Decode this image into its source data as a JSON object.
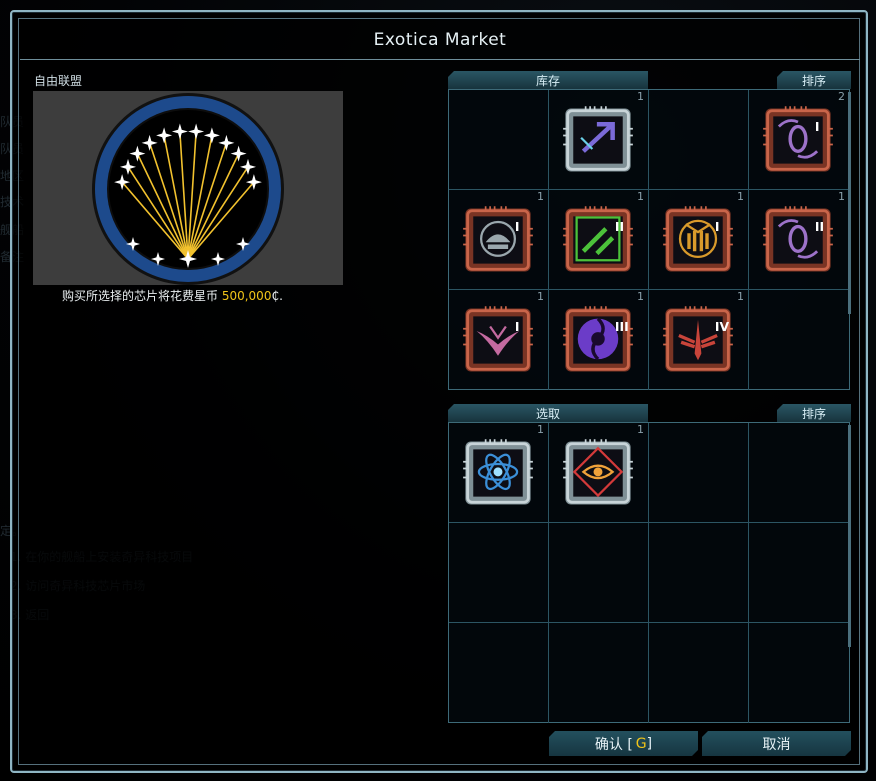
{
  "window": {
    "title": "Exotica Market"
  },
  "faction": {
    "name": "自由联盟"
  },
  "cost": {
    "prefix": "购买所选择的芯片将花费星币 ",
    "amount": "500,000",
    "unit": "₵."
  },
  "background_ghost": {
    "lines": [
      "队员",
      "队员",
      "地区",
      "技术",
      "舰船",
      "备注",
      "定。",
      "1. 在你的舰船上安装奇异科技项目",
      "2. 访问奇异科技芯片市场",
      "3. 返回"
    ]
  },
  "inventory": {
    "tab_label": "库存",
    "sort_label": "排序",
    "cells": [
      {
        "count": "",
        "chip": null
      },
      {
        "count": "1",
        "chip": {
          "icon": "arrow-shard-icon",
          "frame": "silver",
          "color": "#7b6ad8",
          "tier": ""
        }
      },
      {
        "count": "",
        "chip": null
      },
      {
        "count": "2",
        "chip": {
          "icon": "vortex-zero-icon",
          "frame": "copper",
          "color": "#9d72c9",
          "tier": "I"
        }
      },
      {
        "count": "1",
        "chip": {
          "icon": "dome-turret-icon",
          "frame": "copper",
          "color": "#9aa7ad",
          "tier": "I"
        }
      },
      {
        "count": "1",
        "chip": {
          "icon": "green-arrows-icon",
          "frame": "copper",
          "color": "#4cc23a",
          "tier": "II"
        }
      },
      {
        "count": "1",
        "chip": {
          "icon": "missile-volley-icon",
          "frame": "copper",
          "color": "#d99a2b",
          "tier": "I"
        }
      },
      {
        "count": "1",
        "chip": {
          "icon": "vortex-zero-icon",
          "frame": "copper",
          "color": "#9d72c9",
          "tier": "II"
        }
      },
      {
        "count": "1",
        "chip": {
          "icon": "winged-shield-icon",
          "frame": "copper",
          "color": "#c46aa0",
          "tier": "I"
        }
      },
      {
        "count": "1",
        "chip": {
          "icon": "purple-swirl-icon",
          "frame": "copper",
          "color": "#6b3cc8",
          "tier": "III"
        }
      },
      {
        "count": "1",
        "chip": {
          "icon": "red-wing-dagger-icon",
          "frame": "copper",
          "color": "#c8443a",
          "tier": "IV"
        }
      },
      {
        "count": "",
        "chip": null
      }
    ]
  },
  "selection": {
    "tab_label": "选取",
    "sort_label": "排序",
    "cells": [
      {
        "count": "1",
        "chip": {
          "icon": "atom-star-icon",
          "frame": "silver",
          "color": "#3b8fd8",
          "tier": ""
        }
      },
      {
        "count": "1",
        "chip": {
          "icon": "red-eye-diamond-icon",
          "frame": "silver",
          "color": "#d43a3a",
          "tier": ""
        }
      },
      {
        "count": "",
        "chip": null
      },
      {
        "count": "",
        "chip": null
      },
      {
        "count": "",
        "chip": null
      },
      {
        "count": "",
        "chip": null
      },
      {
        "count": "",
        "chip": null
      },
      {
        "count": "",
        "chip": null
      },
      {
        "count": "",
        "chip": null
      },
      {
        "count": "",
        "chip": null
      },
      {
        "count": "",
        "chip": null
      },
      {
        "count": "",
        "chip": null
      }
    ]
  },
  "buttons": {
    "confirm_label": "确认 [",
    "confirm_hotkey": "G",
    "confirm_close": "]",
    "cancel_label": "取消"
  },
  "colors": {
    "accent": "#f0c419",
    "frame": "#8fb6c4",
    "emblem_blue": "#1d4a8c"
  }
}
